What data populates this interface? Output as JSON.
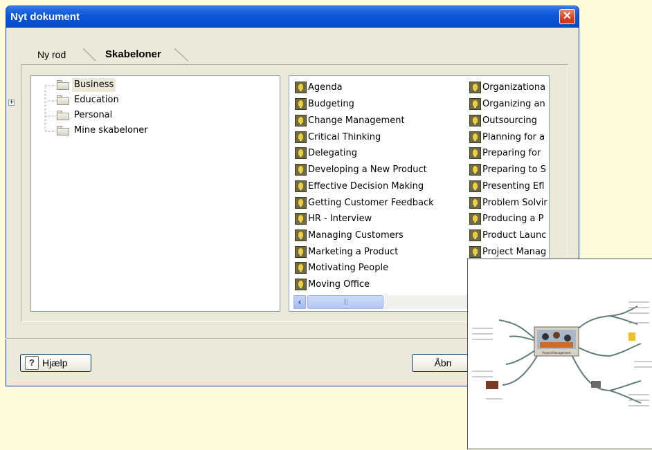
{
  "dialog": {
    "title": "Nyt dokument",
    "close_glyph": "✕"
  },
  "tabs": {
    "ny_rod": "Ny rod",
    "skabeloner": "Skabeloner"
  },
  "tree": {
    "expander_glyph": "+",
    "items": [
      "Business",
      "Education",
      "Personal",
      "Mine skabeloner"
    ],
    "selected": "Business"
  },
  "templates": {
    "column1": [
      "Agenda",
      "Budgeting",
      "Change Management",
      "Critical Thinking",
      "Delegating",
      "Developing a New Product",
      "Effective Decision Making",
      "Getting Customer Feedback",
      "HR - Interview",
      "Managing Customers",
      "Marketing a Product",
      "Motivating People",
      "Moving Office"
    ],
    "column2": [
      "Organizationa",
      "Organizing an",
      "Outsourcing",
      "Planning for a",
      "Preparing for",
      "Preparing to S",
      "Presenting Efl",
      "Problem Solvir",
      "Producing a P",
      "Product Launc",
      "Project Manag"
    ],
    "icon": "lightbulb-icon"
  },
  "scrollbar": {
    "left_arrow": "‹",
    "thumb_grip": "|||"
  },
  "buttons": {
    "help": "Hjælp",
    "help_icon_glyph": "?",
    "open": "Åbn"
  },
  "preview": {
    "center_caption": "Project Management"
  }
}
